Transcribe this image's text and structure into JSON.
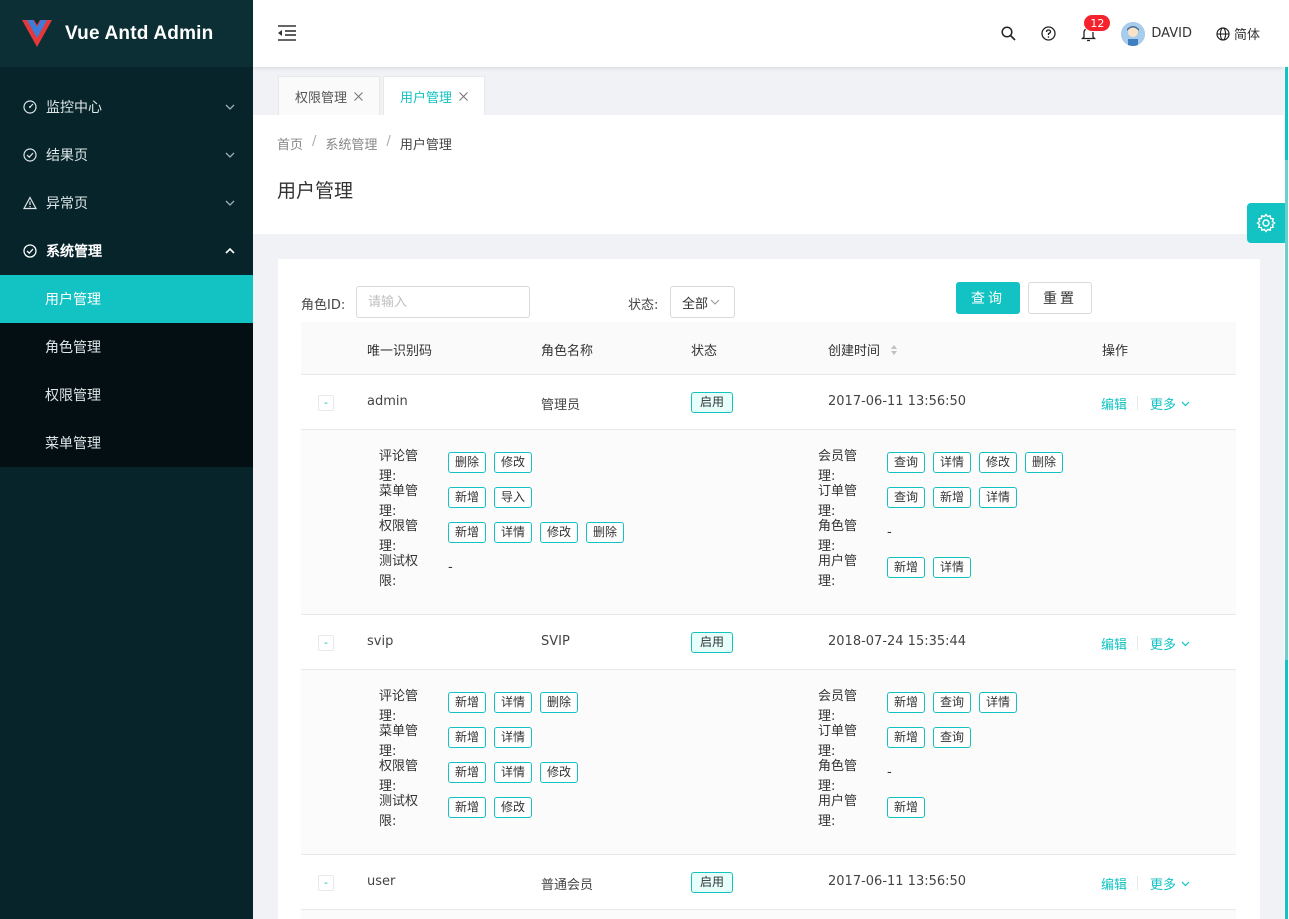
{
  "app": {
    "title": "Vue Antd Admin",
    "accent": "#13c2c2",
    "sidebar_bg": "#06242a"
  },
  "sidebar": {
    "items": [
      {
        "label": "监控中心",
        "icon": "dashboard-icon"
      },
      {
        "label": "结果页",
        "icon": "check-circle-icon"
      },
      {
        "label": "异常页",
        "icon": "warning-icon"
      },
      {
        "label": "系统管理",
        "icon": "check-circle-icon"
      }
    ],
    "sub_items": [
      {
        "label": "用户管理",
        "active": true
      },
      {
        "label": "角色管理"
      },
      {
        "label": "权限管理"
      },
      {
        "label": "菜单管理"
      }
    ]
  },
  "header": {
    "notification_count": "12",
    "user_name": "DAVID",
    "language": "简体"
  },
  "tabs": [
    {
      "label": "权限管理"
    },
    {
      "label": "用户管理",
      "active": true
    }
  ],
  "breadcrumb": [
    "首页",
    "系统管理",
    "用户管理"
  ],
  "page_title": "用户管理",
  "filter": {
    "role_id_label": "角色ID:",
    "role_id_placeholder": "请输入",
    "status_label": "状态:",
    "status_value": "全部",
    "query_label": "查询",
    "reset_label": "重置"
  },
  "table": {
    "columns": [
      "唯一识别码",
      "角色名称",
      "状态",
      "创建时间",
      "操作"
    ],
    "edit_label": "编辑",
    "more_label": "更多",
    "rows": [
      {
        "id": "admin",
        "name": "管理员",
        "status": "启用",
        "created": "2017-06-11 13:56:50",
        "left": [
          {
            "label": "评论管理:",
            "tags": [
              "删除",
              "修改"
            ]
          },
          {
            "label": "菜单管理:",
            "tags": [
              "新增",
              "导入"
            ]
          },
          {
            "label": "权限管理:",
            "tags": [
              "新增",
              "详情",
              "修改",
              "删除"
            ]
          },
          {
            "label": "测试权限:",
            "tags": [],
            "dash": "-"
          }
        ],
        "right": [
          {
            "label": "会员管理:",
            "tags": [
              "查询",
              "详情",
              "修改",
              "删除"
            ]
          },
          {
            "label": "订单管理:",
            "tags": [
              "查询",
              "新增",
              "详情"
            ]
          },
          {
            "label": "角色管理:",
            "tags": [],
            "dash": "-"
          },
          {
            "label": "用户管理:",
            "tags": [
              "新增",
              "详情"
            ]
          }
        ]
      },
      {
        "id": "svip",
        "name": "SVIP",
        "status": "启用",
        "created": "2018-07-24 15:35:44",
        "left": [
          {
            "label": "评论管理:",
            "tags": [
              "新增",
              "详情",
              "删除"
            ]
          },
          {
            "label": "菜单管理:",
            "tags": [
              "新增",
              "详情"
            ]
          },
          {
            "label": "权限管理:",
            "tags": [
              "新增",
              "详情",
              "修改"
            ]
          },
          {
            "label": "测试权限:",
            "tags": [
              "新增",
              "修改"
            ]
          }
        ],
        "right": [
          {
            "label": "会员管理:",
            "tags": [
              "新增",
              "查询",
              "详情"
            ]
          },
          {
            "label": "订单管理:",
            "tags": [
              "新增",
              "查询"
            ]
          },
          {
            "label": "角色管理:",
            "tags": [],
            "dash": "-"
          },
          {
            "label": "用户管理:",
            "tags": [
              "新增"
            ]
          }
        ]
      },
      {
        "id": "user",
        "name": "普通会员",
        "status": "启用",
        "created": "2017-06-11 13:56:50"
      }
    ]
  }
}
